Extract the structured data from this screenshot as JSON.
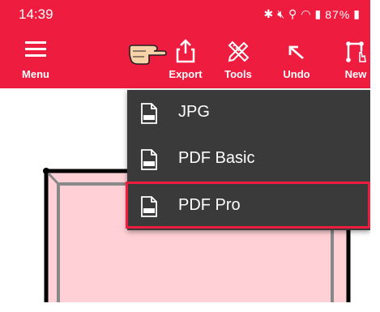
{
  "status_bar": {
    "time": "14:39",
    "battery": "87%",
    "icons": [
      "bluetooth-icon",
      "mute-icon",
      "location-icon",
      "wifi-icon",
      "signal-icon",
      "battery-icon"
    ]
  },
  "toolbar": {
    "menu_label": "Menu",
    "export_label": "Export",
    "tools_label": "Tools",
    "undo_label": "Undo",
    "new_label": "New"
  },
  "export_menu": {
    "items": [
      {
        "label": "JPG",
        "icon": "jpg-file-icon"
      },
      {
        "label": "PDF Basic",
        "icon": "pdf-file-icon"
      },
      {
        "label": "PDF Pro",
        "icon": "pdf-file-icon",
        "highlighted": true
      }
    ]
  },
  "colors": {
    "accent": "#ee1c3e",
    "menu_bg": "#3a3a3a",
    "room_fill": "#ffd0d6"
  }
}
